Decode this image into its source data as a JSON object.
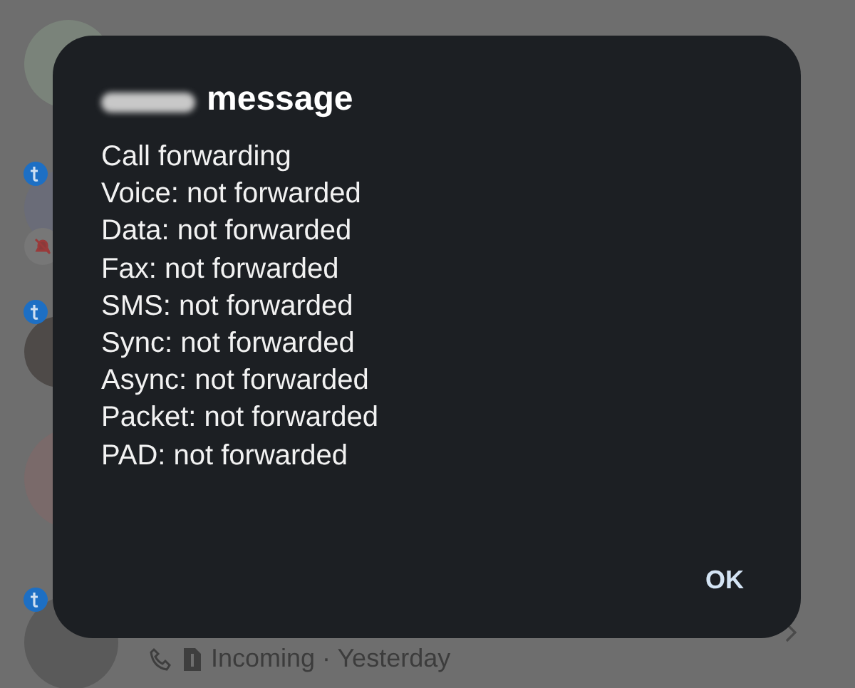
{
  "background": {
    "call_status": "Incoming · Yesterday"
  },
  "dialog": {
    "title": "message",
    "lines": [
      "Call forwarding",
      "Voice: not forwarded",
      "Data: not forwarded",
      "Fax: not forwarded",
      "SMS: not forwarded",
      "Sync: not forwarded",
      "Async: not forwarded",
      "Packet: not forwarded",
      "PAD: not forwarded"
    ],
    "buttons": [
      "OK"
    ]
  }
}
